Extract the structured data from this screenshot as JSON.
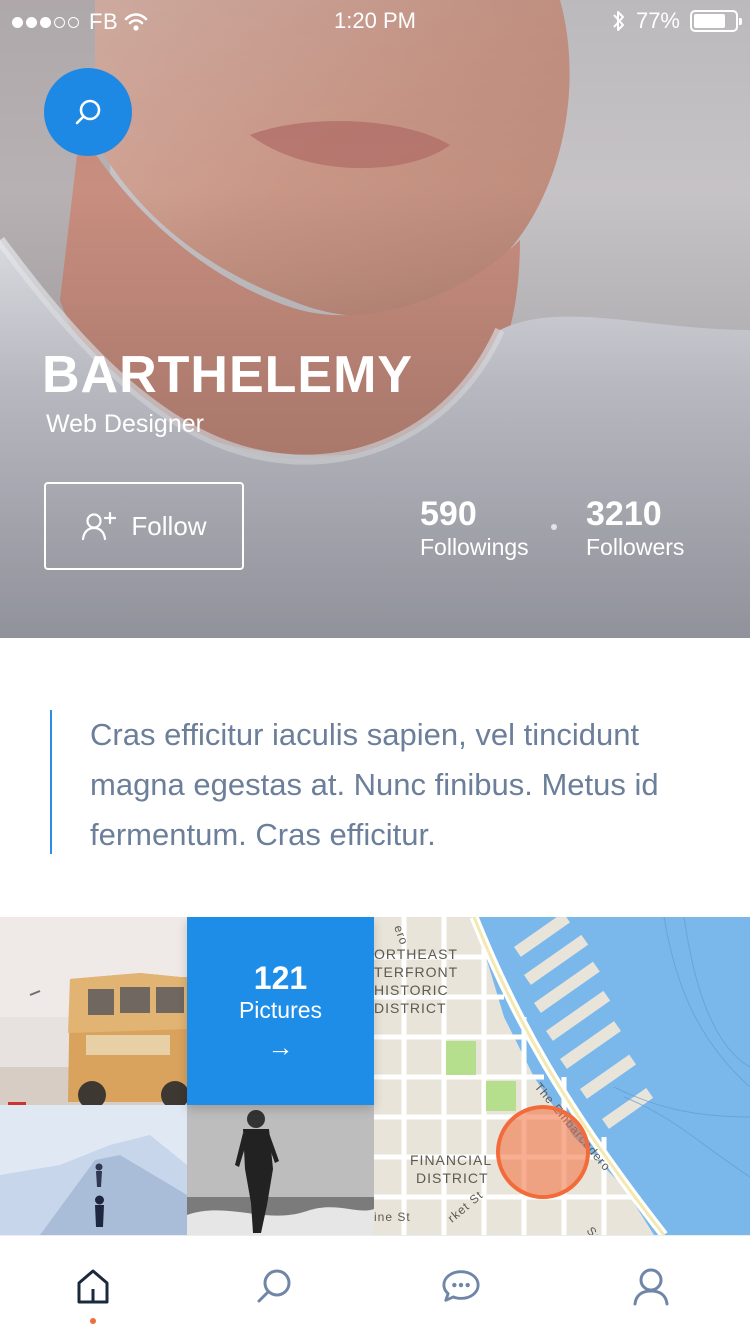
{
  "status_bar": {
    "carrier": "FB",
    "time": "1:20 PM",
    "battery": "77%",
    "battery_level": 0.77,
    "signal_bars_filled": 3,
    "signal_bars_total": 5
  },
  "profile": {
    "name": "BARTHELEMY",
    "role": "Web Designer",
    "follow_label": "Follow",
    "stats": [
      {
        "value": "590",
        "label": "Followings"
      },
      {
        "value": "3210",
        "label": "Followers"
      }
    ]
  },
  "bio": {
    "text": "Cras efficitur iaculis sapien, vel tincidunt magna egestas at. Nunc finibus. Metus id fermentum. Cras efficitur."
  },
  "gallery": {
    "count": "121",
    "count_label": "Pictures",
    "arrow": "→"
  },
  "map": {
    "labels": [
      "ORTHEAST",
      "TERFRONT",
      "HISTORIC",
      "DISTRICT",
      "FINANCIAL",
      "DISTRICT",
      "The Embarcadero",
      "ero",
      "ine St",
      "rket St",
      "Sp"
    ]
  },
  "tabbar": {
    "items": [
      "home-icon",
      "search-icon",
      "chat-icon",
      "profile-icon"
    ],
    "active": "home"
  },
  "colors": {
    "accent": "#1e88e5",
    "bio_text": "#6c7f9a",
    "indicator": "#f26b3a",
    "map_marker": "#f26b3a"
  }
}
